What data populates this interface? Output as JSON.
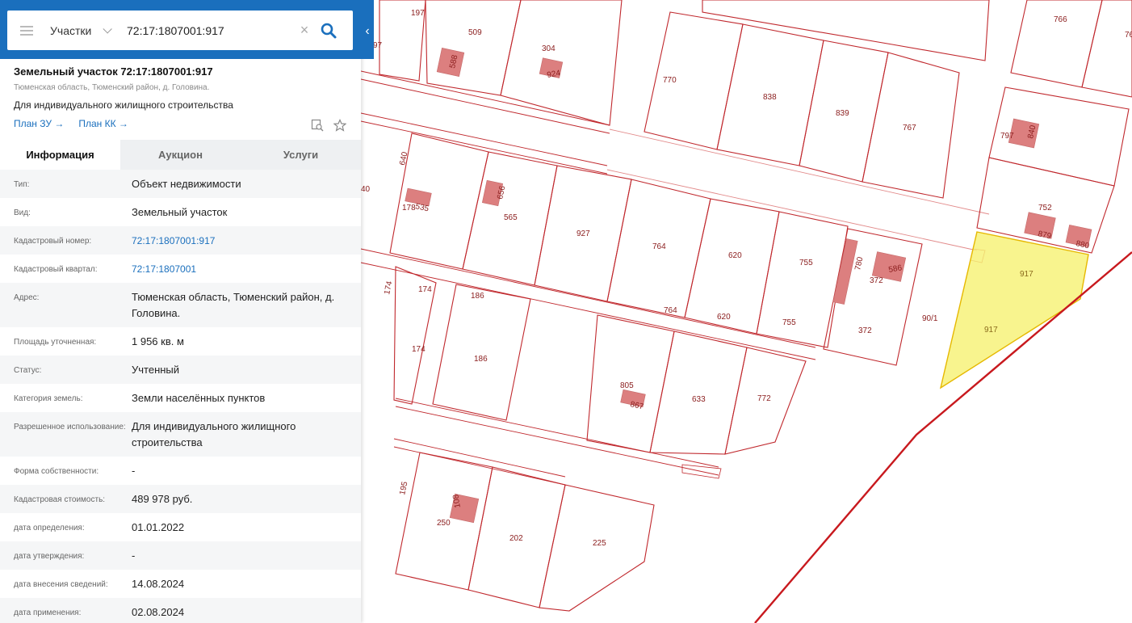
{
  "search": {
    "mode": "Участки",
    "value": "72:17:1807001:917"
  },
  "header": {
    "title": "Земельный участок 72:17:1807001:917",
    "address": "Тюменская область, Тюменский район, д. Головина.",
    "purpose": "Для индивидуального жилищного строительства",
    "link_plan_zu": "План ЗУ →",
    "link_plan_kk": "План КК →"
  },
  "tabs": [
    {
      "label": "Информация",
      "active": true
    },
    {
      "label": "Аукцион",
      "active": false
    },
    {
      "label": "Услуги",
      "active": false
    }
  ],
  "rows": [
    {
      "key": "Тип:",
      "value": "Объект недвижимости"
    },
    {
      "key": "Вид:",
      "value": "Земельный участок"
    },
    {
      "key": "Кадастровый номер:",
      "value": "72:17:1807001:917",
      "link": true
    },
    {
      "key": "Кадастровый квартал:",
      "value": "72:17:1807001",
      "link": true
    },
    {
      "key": "Адрес:",
      "value": "Тюменская область, Тюменский район, д. Головина."
    },
    {
      "key": "Площадь уточненная:",
      "value": "1 956 кв. м"
    },
    {
      "key": "Статус:",
      "value": "Учтенный"
    },
    {
      "key": "Категория земель:",
      "value": "Земли населённых пунктов"
    },
    {
      "key": "Разрешенное использование:",
      "value": "Для индивидуального жилищного строительства"
    },
    {
      "key": "Форма собственности:",
      "value": "-"
    },
    {
      "key": "Кадастровая стоимость:",
      "value": "489 978 руб."
    },
    {
      "key": "дата определения:",
      "value": "01.01.2022"
    },
    {
      "key": "дата утверждения:",
      "value": "-"
    },
    {
      "key": "дата внесения сведений:",
      "value": "14.08.2024"
    },
    {
      "key": "дата применения:",
      "value": "02.08.2024"
    }
  ],
  "map_labels": [
    "197",
    "509",
    "304",
    "97",
    "588",
    "924",
    "770",
    "838",
    "839",
    "767",
    "766",
    "76",
    "797",
    "840",
    "752",
    "879",
    "880",
    "917",
    "917",
    "640",
    "40",
    "178",
    "535",
    "656",
    "565",
    "927",
    "764",
    "620",
    "755",
    "780",
    "586",
    "372",
    "174",
    "174",
    "186",
    "186",
    "174",
    "764",
    "620",
    "755",
    "372",
    "90/1",
    "805",
    "867",
    "633",
    "772",
    "195",
    "250",
    "108",
    "202",
    "225"
  ],
  "colors": {
    "accent": "#1a6fbd",
    "plot_line": "#c0282d",
    "selected_fill": "#f7f27a",
    "building": "#dc7f7f"
  },
  "icons": [
    "menu-icon",
    "chevron-down-icon",
    "clear-icon",
    "search-icon",
    "collapse-icon",
    "map-search-icon",
    "star-icon"
  ]
}
